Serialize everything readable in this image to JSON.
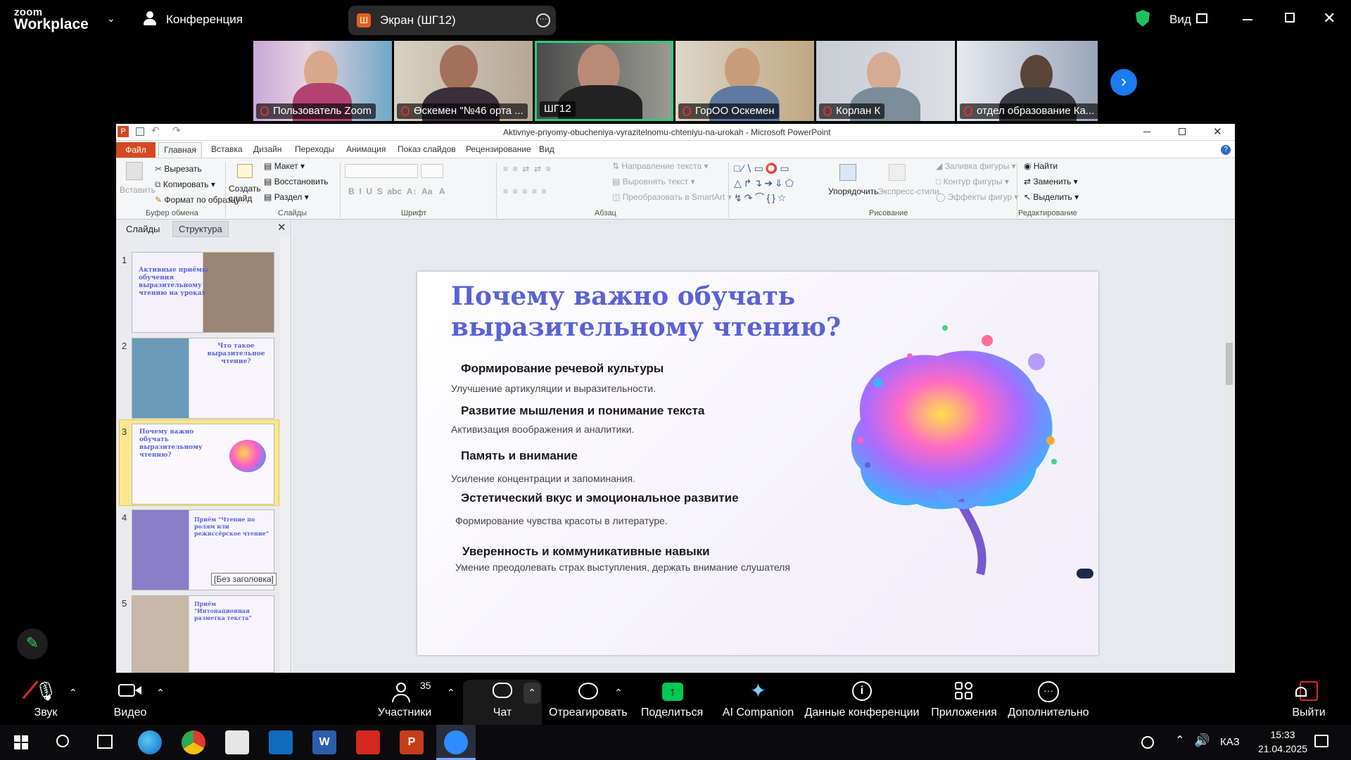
{
  "zoom": {
    "logo_line1": "zoom",
    "logo_line2": "Workplace",
    "conference_label": "Конференция",
    "screen_share_label": "Экран (ШГ12)",
    "view_label": "Вид",
    "participants": [
      {
        "name": "Пользователь Zoom"
      },
      {
        "name": "Өскемен \"№46 орта ..."
      },
      {
        "name": "ШГ12"
      },
      {
        "name": "ГорОО Оскемен"
      },
      {
        "name": "Корлан К"
      },
      {
        "name": "отдел образование Ка..."
      }
    ],
    "toolbar": {
      "audio": "Звук",
      "video": "Видео",
      "participants": "Участники",
      "participants_count": "35",
      "chat": "Чат",
      "react": "Отреагировать",
      "share": "Поделиться",
      "ai": "AI Companion",
      "info": "Данные конференции",
      "apps": "Приложения",
      "more": "Дополнительно",
      "leave": "Выйти"
    },
    "accent_green": "#00c853",
    "leave_red": "#e02828"
  },
  "ppt": {
    "window_title": "Aktivnye-priyomy-obucheniya-vyrazitelnomu-chteniyu-na-urokah - Microsoft PowerPoint",
    "tabs": [
      "Файл",
      "Главная",
      "Вставка",
      "Дизайн",
      "Переходы",
      "Анимация",
      "Показ слайдов",
      "Рецензирование",
      "Вид"
    ],
    "ribbon": {
      "paste": "Вставить",
      "cut": "Вырезать",
      "copy": "Копировать",
      "format_painter": "Формат по образцу",
      "clipboard_group": "Буфер обмена",
      "new_slide": "Создать слайд",
      "layout": "Макет",
      "reset": "Восстановить",
      "section": "Раздел",
      "slides_group": "Слайды",
      "font_group": "Шрифт",
      "paragraph_group": "Абзац",
      "text_direction": "Направление текста",
      "align_text": "Выровнять текст",
      "smartart": "Преобразовать в SmartArt",
      "arrange": "Упорядочить",
      "quick_styles": "Экспресс-стили",
      "shape_fill": "Заливка фигуры",
      "shape_outline": "Контур фигуры",
      "shape_effects": "Эффекты фигур",
      "drawing_group": "Рисование",
      "find": "Найти",
      "replace": "Заменить",
      "select": "Выделить",
      "editing_group": "Редактирование"
    },
    "pane_tabs": [
      "Слайды",
      "Структура"
    ],
    "tooltip": "[Без заголовка]",
    "thumbnails": [
      {
        "num": "1",
        "title": "Активные приёмы обучения выразительному чтению на уроках"
      },
      {
        "num": "2",
        "title": "Что такое выразительное чтение?"
      },
      {
        "num": "3",
        "title": "Почему важно обучать выразительному чтению?"
      },
      {
        "num": "4",
        "title": "Приём \"Чтение по ролям или режиссёрское чтение\""
      },
      {
        "num": "5",
        "title": "Приём \"Интонационная разметка текста\""
      }
    ],
    "slide": {
      "title_line1": "Почему важно обучать",
      "title_line2": "выразительному  чтению?",
      "items": [
        {
          "heading": "Формирование речевой культуры",
          "text": "Улучшение артикуляции и выразительности."
        },
        {
          "heading": "Развитие  мышления   и понимание текста",
          "text": "Активизация воображения и аналитики."
        },
        {
          "heading": "Память  и внимание",
          "text": "Усиление концентрации и запоминания."
        },
        {
          "heading": "Эстетический вкус и эмоциональное развитие",
          "text": "Формирование чувства красоты в литературе."
        },
        {
          "heading": "Уверенность и коммуникативные навыки",
          "text": "Умение преодолевать страх выступления, держать внимание слушателя"
        }
      ]
    }
  },
  "taskbar": {
    "lang": "КАЗ",
    "time": "15:33",
    "date": "21.04.2025"
  }
}
